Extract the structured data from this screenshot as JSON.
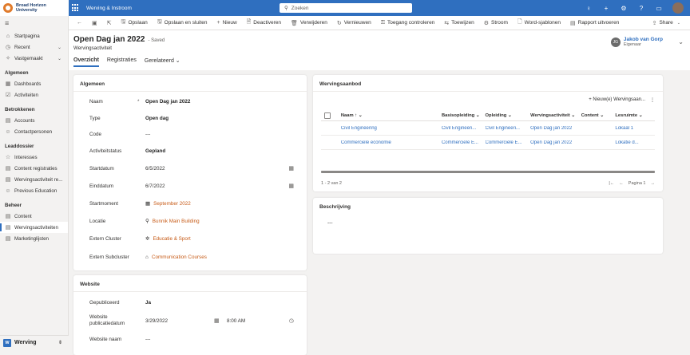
{
  "topbar": {
    "logo_line1": "Broad Horizon",
    "logo_line2": "University",
    "app_name": "Werving & Instroom",
    "search_placeholder": "Zoeken"
  },
  "commands": [
    {
      "icon": "←",
      "label": "",
      "name": "back-button"
    },
    {
      "icon": "▣",
      "label": "",
      "name": "form-view-button"
    },
    {
      "icon": "⇱",
      "label": "",
      "name": "open-new-window-button"
    },
    {
      "icon": "🖫",
      "label": "Opslaan",
      "name": "save-button"
    },
    {
      "icon": "🖫",
      "label": "Opslaan en sluiten",
      "name": "save-and-close-button"
    },
    {
      "icon": "+",
      "label": "Nieuw",
      "name": "new-button"
    },
    {
      "icon": "🗎",
      "label": "Deactiveren",
      "name": "deactivate-button"
    },
    {
      "icon": "🗑",
      "label": "Verwijderen",
      "name": "delete-button"
    },
    {
      "icon": "↻",
      "label": "Vernieuwen",
      "name": "refresh-button"
    },
    {
      "icon": "⚿",
      "label": "Toegang controleren",
      "name": "check-access-button"
    },
    {
      "icon": "⇆",
      "label": "Toewijzen",
      "name": "assign-button"
    },
    {
      "icon": "⚙",
      "label": "Stroom",
      "name": "flow-button"
    },
    {
      "icon": "🗋",
      "label": "Word-sjablonen",
      "name": "word-templates-button"
    },
    {
      "icon": "▤",
      "label": "Rapport uitvoeren",
      "name": "run-report-button"
    }
  ],
  "share_label": "Share",
  "sidebar": {
    "top": [
      {
        "icon": "⌂",
        "label": "Startpagina",
        "name": "sidebar-item-home"
      },
      {
        "icon": "◷",
        "label": "Recent",
        "name": "sidebar-item-recent",
        "chev": "⌄"
      },
      {
        "icon": "✧",
        "label": "Vastgemaakt",
        "name": "sidebar-item-pinned",
        "chev": "⌄"
      }
    ],
    "groups": [
      {
        "title": "Algemeen",
        "items": [
          {
            "icon": "▦",
            "label": "Dashboards",
            "name": "sidebar-item-dashboards"
          },
          {
            "icon": "☑",
            "label": "Activiteiten",
            "name": "sidebar-item-activities"
          }
        ]
      },
      {
        "title": "Betrokkenen",
        "items": [
          {
            "icon": "▤",
            "label": "Accounts",
            "name": "sidebar-item-accounts"
          },
          {
            "icon": "☺",
            "label": "Contactpersonen",
            "name": "sidebar-item-contacts"
          }
        ]
      },
      {
        "title": "Leaddossier",
        "items": [
          {
            "icon": "☆",
            "label": "Interesses",
            "name": "sidebar-item-interests"
          },
          {
            "icon": "▤",
            "label": "Content registraties",
            "name": "sidebar-item-content-registrations"
          },
          {
            "icon": "▤",
            "label": "Wervingsactiviteit re...",
            "name": "sidebar-item-recruitment-activity-registrations"
          },
          {
            "icon": "☺",
            "label": "Previous Education",
            "name": "sidebar-item-previous-education"
          }
        ]
      },
      {
        "title": "Beheer",
        "items": [
          {
            "icon": "▤",
            "label": "Content",
            "name": "sidebar-item-content"
          },
          {
            "icon": "▤",
            "label": "Wervingsactiviteiten",
            "name": "sidebar-item-recruitment-activities",
            "active": true
          },
          {
            "icon": "▤",
            "label": "Marketinglijsten",
            "name": "sidebar-item-marketing-lists"
          }
        ]
      }
    ],
    "area_badge": "W",
    "area_label": "Werving"
  },
  "record": {
    "title": "Open Dag jan 2022",
    "saved": "- Saved",
    "entity": "Wervingsactiviteit",
    "owner_initials": "JG",
    "owner_name": "Jakob van Gorp",
    "owner_role": "Eigenaar",
    "tabs": [
      {
        "label": "Overzicht",
        "active": true
      },
      {
        "label": "Registraties"
      },
      {
        "label": "Gerelateerd ⌄"
      }
    ]
  },
  "general": {
    "title": "Algemeen",
    "fields": [
      {
        "label": "Naam",
        "req": "*",
        "value": "Open Dag jan 2022",
        "style": ""
      },
      {
        "label": "Type",
        "value": "Open dag",
        "style": ""
      },
      {
        "label": "Code",
        "value": "---",
        "style": "muted"
      },
      {
        "label": "Activiteitstatus",
        "value": "Gepland",
        "style": ""
      },
      {
        "label": "Startdatum",
        "value": "6/5/2022",
        "style": "muted",
        "cal": "▦"
      },
      {
        "label": "Einddatum",
        "value": "6/7/2022",
        "style": "muted",
        "cal": "▦"
      },
      {
        "label": "Startmoment",
        "value": "September 2022",
        "style": "link",
        "icon": "▦"
      },
      {
        "label": "Locatie",
        "value": "Bunnik Main Building",
        "style": "link",
        "icon": "⚲"
      },
      {
        "label": "Extern Cluster",
        "value": "Educatie & Sport",
        "style": "link",
        "icon": "✲"
      },
      {
        "label": "Extern Subcluster",
        "value": "Communication Courses",
        "style": "link",
        "icon": "⌂"
      }
    ]
  },
  "website": {
    "title": "Website",
    "published_label": "Gepubliceerd",
    "published_value": "Ja",
    "pubdate_label1": "Website",
    "pubdate_label2": "publicatiedatum",
    "pubdate_date": "3/29/2022",
    "pubdate_time": "8:00 AM",
    "name_label": "Website naam",
    "name_value": "---"
  },
  "offer": {
    "title": "Wervingsaanbod",
    "new_label": "Nieuw(e) Wervingsaan...",
    "columns": [
      "Naam ↑ ⌄",
      "Basisopleiding ⌄",
      "Opleiding ⌄",
      "Wervingsactiviteit ⌄",
      "Content ⌄",
      "Lesruimte ⌄"
    ],
    "rows": [
      [
        "Civil Engineering",
        "Civil Engineeri...",
        "Civil Engineeri...",
        "Open Dag jan 2022",
        "",
        "Lokaal 1"
      ],
      [
        "Commerciele economie",
        "Commerciele E...",
        "Commerciele E...",
        "Open Dag jan 2022",
        "",
        "Lokatie d..."
      ]
    ],
    "count": "1 - 2 van 2",
    "page": "Pagina 1"
  },
  "description": {
    "title": "Beschrijving",
    "value": "---"
  }
}
